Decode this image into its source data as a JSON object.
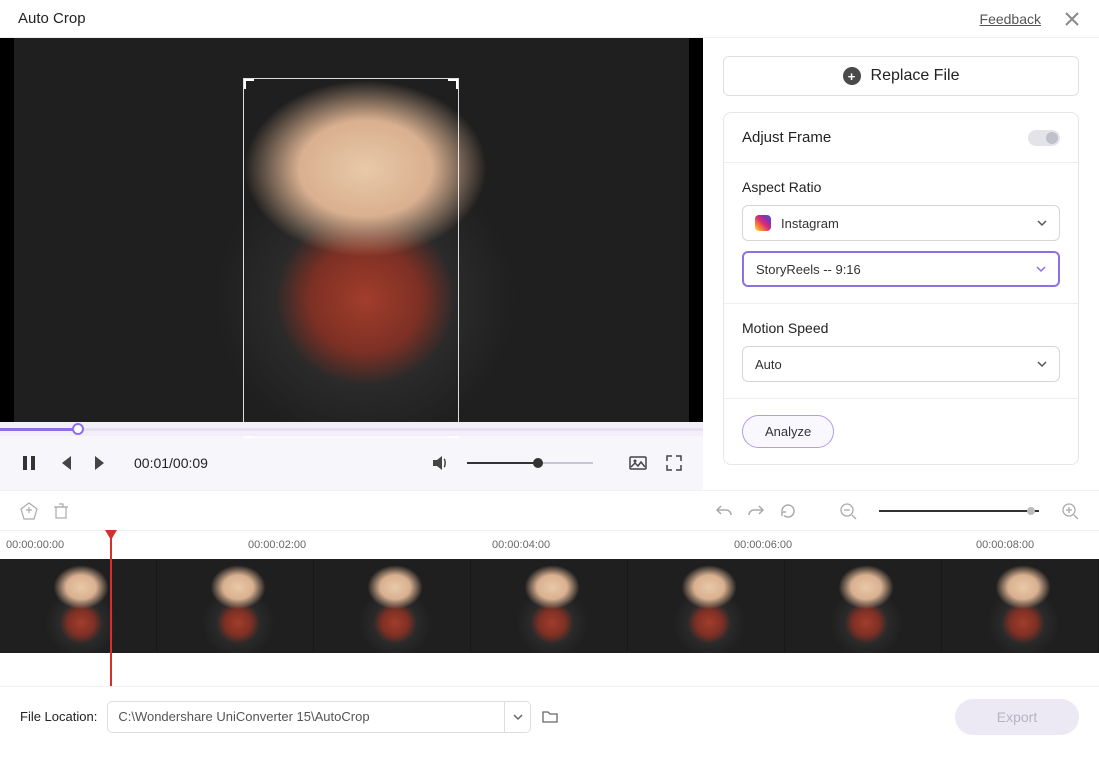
{
  "header": {
    "title": "Auto Crop",
    "feedback": "Feedback"
  },
  "replace_file": "Replace File",
  "panel": {
    "adjust_frame": "Adjust Frame",
    "aspect_ratio_label": "Aspect Ratio",
    "platform": "Instagram",
    "ratio": "StoryReels -- 9:16",
    "motion_speed_label": "Motion Speed",
    "motion_speed": "Auto",
    "analyze": "Analyze"
  },
  "player": {
    "time": "00:01/00:09"
  },
  "timeline": {
    "ticks": [
      "00:00:00:00",
      "00:00:02:00",
      "00:00:04:00",
      "00:00:06:00",
      "00:00:08:00"
    ]
  },
  "footer": {
    "file_location_label": "File Location:",
    "file_location": "C:\\Wondershare UniConverter 15\\AutoCrop",
    "export": "Export"
  }
}
